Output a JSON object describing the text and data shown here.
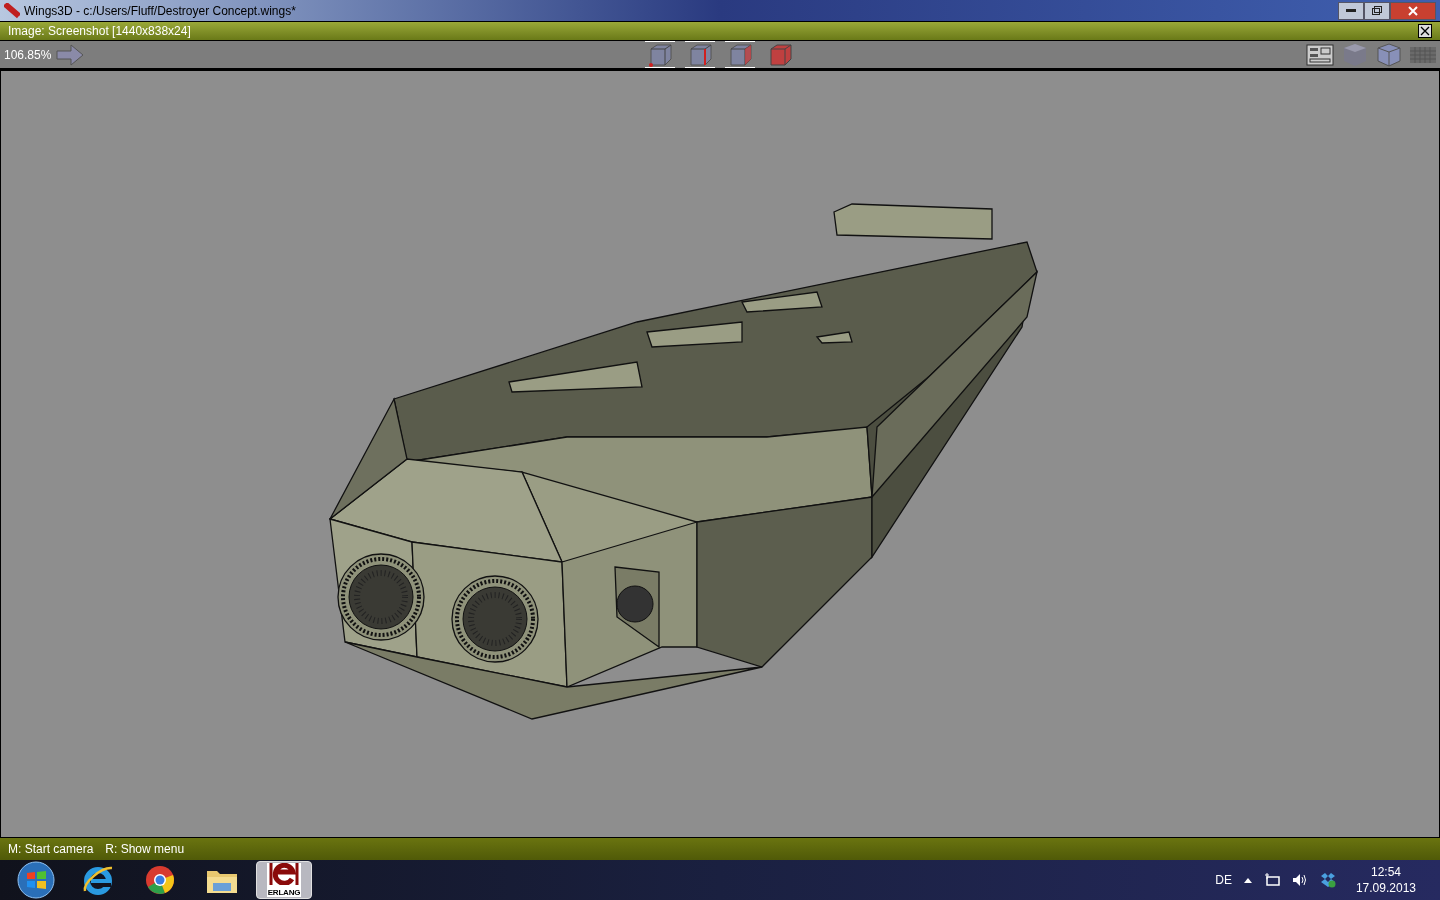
{
  "window": {
    "title": "Wings3D - c:/Users/Fluff/Destroyer Concept.wings*"
  },
  "image_window": {
    "title": "Image: Screenshot [1440x838x24]"
  },
  "toolbar": {
    "zoom": "106.85%",
    "selection_modes": [
      {
        "kind": "vertex",
        "selected": true
      },
      {
        "kind": "edge",
        "selected": true
      },
      {
        "kind": "face",
        "selected": true
      },
      {
        "kind": "body",
        "selected": false
      }
    ],
    "right_tools": [
      {
        "kind": "outliner"
      },
      {
        "kind": "shaded"
      },
      {
        "kind": "wire"
      },
      {
        "kind": "ground"
      }
    ]
  },
  "status_bar": [
    "M: Start camera",
    "R: Show menu"
  ],
  "taskbar": {
    "items": [
      {
        "kind": "start",
        "selected": false
      },
      {
        "kind": "ie",
        "selected": false
      },
      {
        "kind": "chrome",
        "selected": false
      },
      {
        "kind": "folder",
        "selected": false
      },
      {
        "kind": "erlang",
        "selected": true,
        "label": "ERLANG"
      }
    ],
    "language": "DE",
    "time": "12:54",
    "date": "17.09.2013"
  }
}
